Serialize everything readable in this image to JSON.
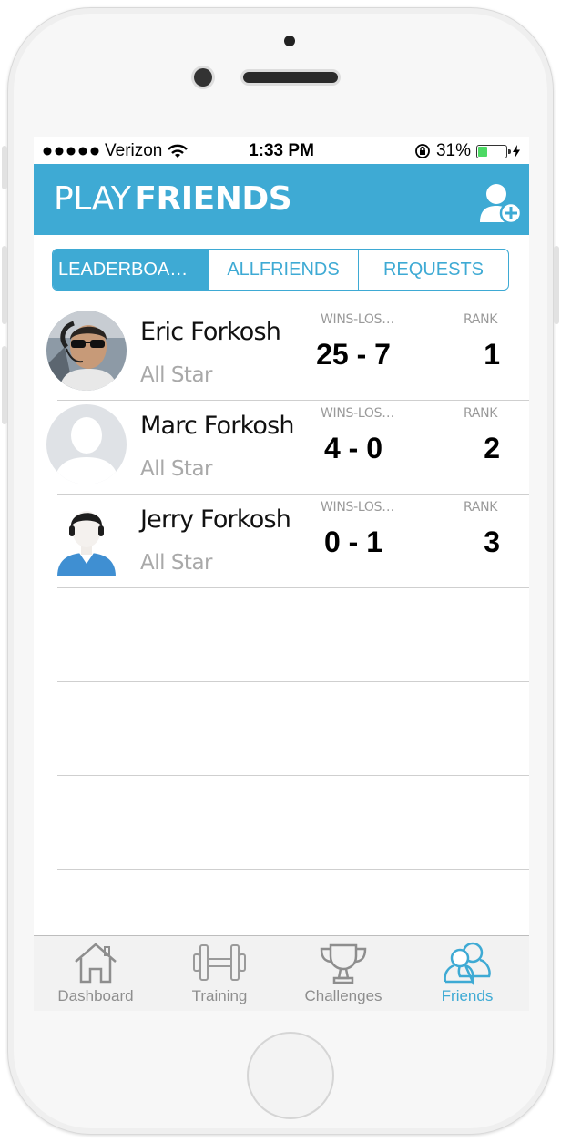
{
  "status_bar": {
    "carrier": "Verizon",
    "time": "1:33 PM",
    "battery": "31%",
    "battery_level": 0.31
  },
  "header": {
    "title_light": "PLAY",
    "title_bold": "FRIENDS",
    "add_friend_icon": "add-friend-icon"
  },
  "segments": [
    {
      "label": "LEADERBOA…",
      "active": true
    },
    {
      "label": "ALLFRIENDS",
      "active": false
    },
    {
      "label": "REQUESTS",
      "active": false
    }
  ],
  "leaderboard": {
    "wins_losses_label": "WINS-LOS…",
    "rank_label": "RANK",
    "rows": [
      {
        "name": "Eric Forkosh",
        "subtitle": "All Star",
        "record": "25 - 7",
        "rank": "1",
        "avatar": "photo"
      },
      {
        "name": "Marc Forkosh",
        "subtitle": "All Star",
        "record": "4 - 0",
        "rank": "2",
        "avatar": "silhouette"
      },
      {
        "name": "Jerry Forkosh",
        "subtitle": "All Star",
        "record": "0 - 1",
        "rank": "3",
        "avatar": "cartoon"
      }
    ]
  },
  "tab_bar": {
    "tabs": [
      {
        "label": "Dashboard",
        "icon": "house-icon",
        "active": false
      },
      {
        "label": "Training",
        "icon": "dumbbell-icon",
        "active": false
      },
      {
        "label": "Challenges",
        "icon": "trophy-icon",
        "active": false
      },
      {
        "label": "Friends",
        "icon": "friends-icon",
        "active": true
      }
    ]
  },
  "colors": {
    "accent": "#3eaad4",
    "secondary_text": "#a9a9a9"
  }
}
